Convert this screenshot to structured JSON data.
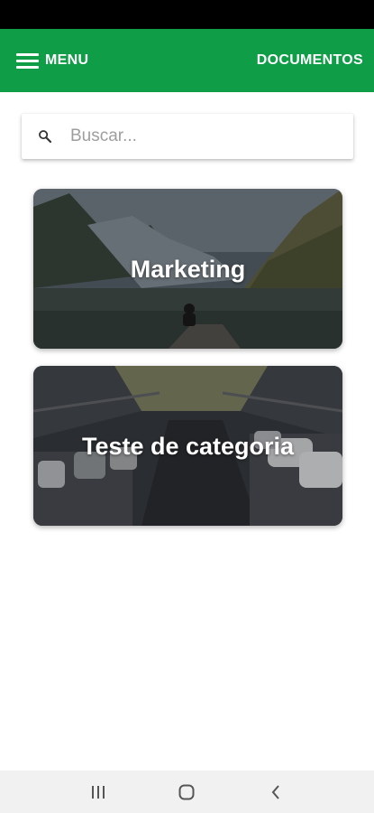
{
  "app_bar": {
    "menu_label": "MENU",
    "documents_label": "DOCUMENTOS",
    "color": "#0f9d48"
  },
  "search": {
    "placeholder": "Buscar..."
  },
  "categories": [
    {
      "title": "Marketing",
      "image": "mountain-lake-photo"
    },
    {
      "title": "Teste de categoria",
      "image": "parking-garage-photo"
    }
  ],
  "nav_bar": {
    "icons": [
      "recent-apps-icon",
      "home-icon",
      "back-icon"
    ]
  }
}
